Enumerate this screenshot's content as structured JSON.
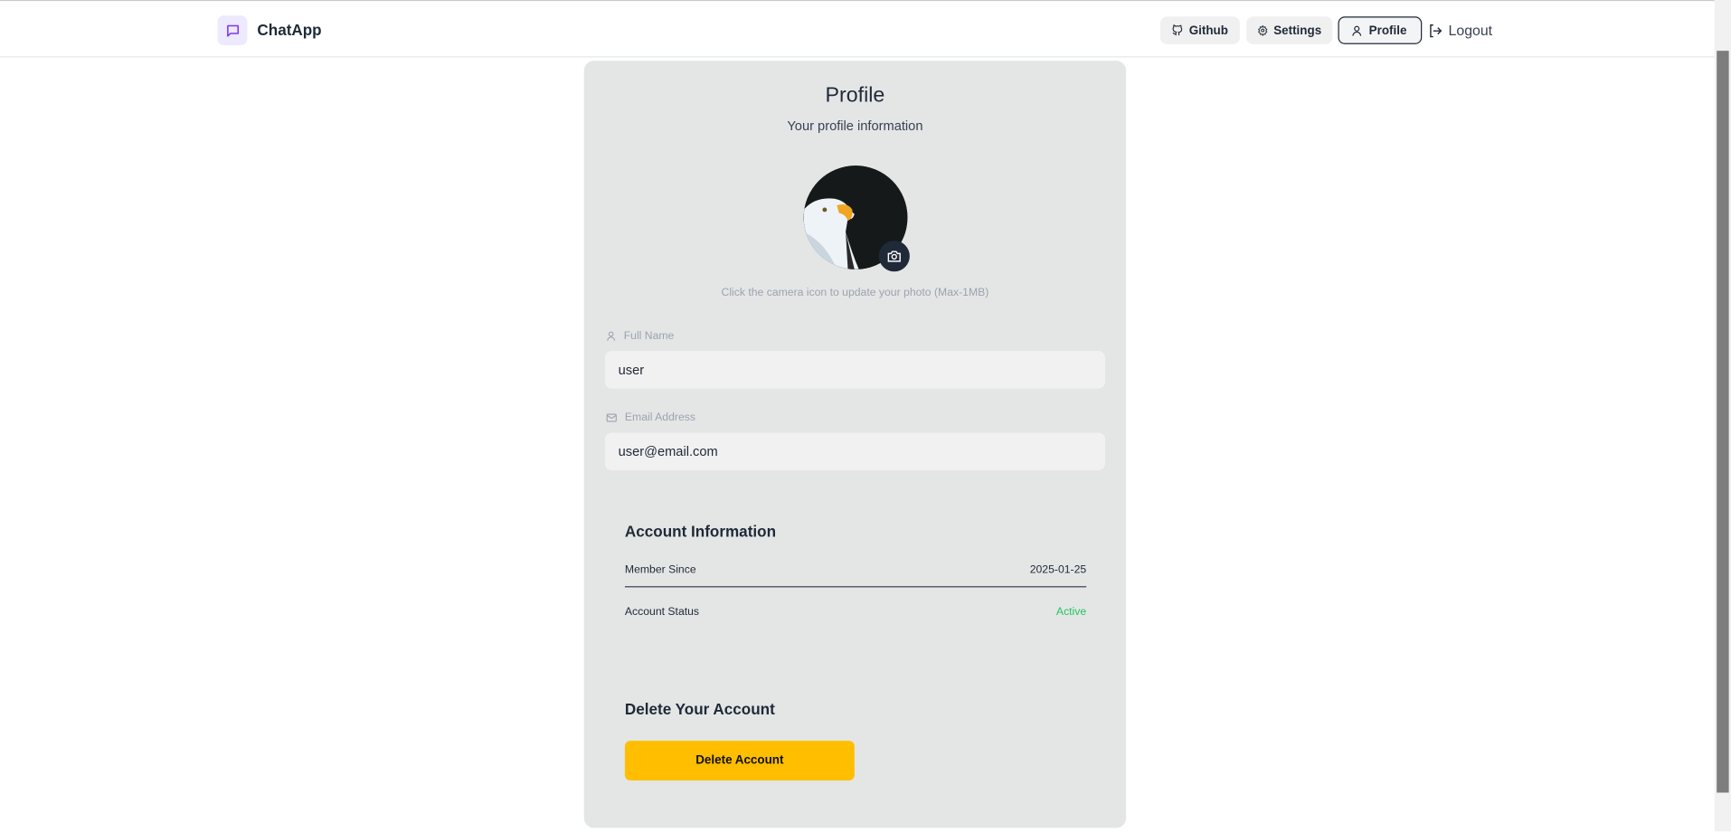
{
  "navbar": {
    "brand": "ChatApp",
    "github": "Github",
    "settings": "Settings",
    "profile": "Profile",
    "logout": "Logout"
  },
  "profile": {
    "title": "Profile",
    "subtitle": "Your profile information",
    "photo_hint": "Click the camera icon to update your photo (Max-1MB)"
  },
  "form": {
    "full_name_label": "Full Name",
    "full_name_value": "user",
    "email_label": "Email Address",
    "email_value": "user@email.com"
  },
  "account": {
    "heading": "Account Information",
    "member_since_label": "Member Since",
    "member_since_value": "2025-01-25",
    "status_label": "Account Status",
    "status_value": "Active",
    "status_color": "#22c55e"
  },
  "danger": {
    "heading": "Delete Your Account",
    "button": "Delete Account",
    "button_color": "#ffbe00"
  },
  "colors": {
    "brand_accent": "#7c3aed"
  }
}
